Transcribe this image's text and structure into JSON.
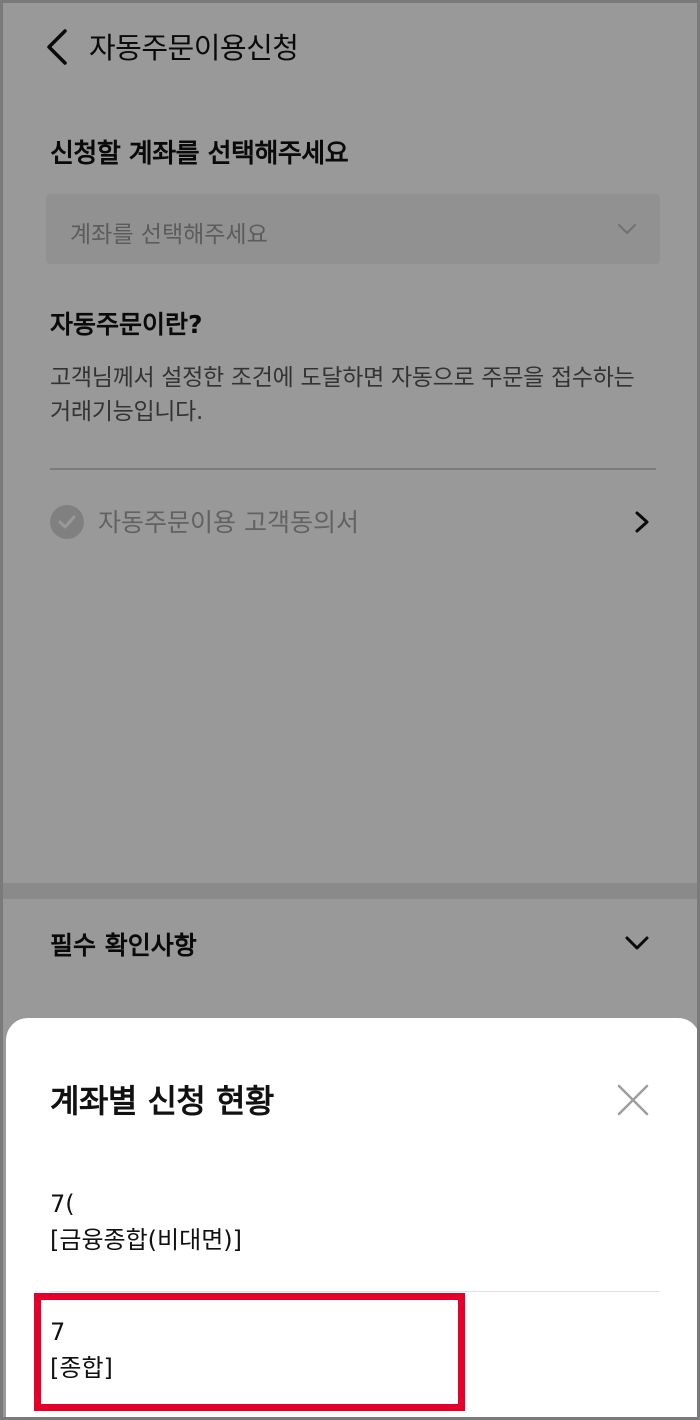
{
  "header": {
    "title": "자동주문이용신청"
  },
  "account_section": {
    "title": "신청할 계좌를 선택해주세요",
    "select_placeholder": "계좌를 선택해주세요"
  },
  "intro": {
    "title": "자동주문이란?",
    "description": "고객님께서 설정한 조건에 도달하면 자동으로 주문을 접수하는 거래기능입니다."
  },
  "consent": {
    "label": "자동주문이용 고객동의서",
    "checked": false
  },
  "notice": {
    "title": "필수 확인사항"
  },
  "sheet": {
    "title": "계좌별 신청 현황",
    "accounts": [
      {
        "number": "7(",
        "type": "[금융종합(비대면)]"
      },
      {
        "number": "7",
        "type": "[종합]"
      }
    ]
  },
  "colors": {
    "highlight": "#e4002b",
    "dim_overlay": "rgba(0,0,0,0.40)"
  },
  "icons": {
    "back": "chevron-left-icon",
    "select": "chevron-down-icon",
    "consent": "check-circle-icon",
    "consent_arrow": "chevron-right-icon",
    "notice": "chevron-down-icon",
    "close": "close-icon"
  }
}
